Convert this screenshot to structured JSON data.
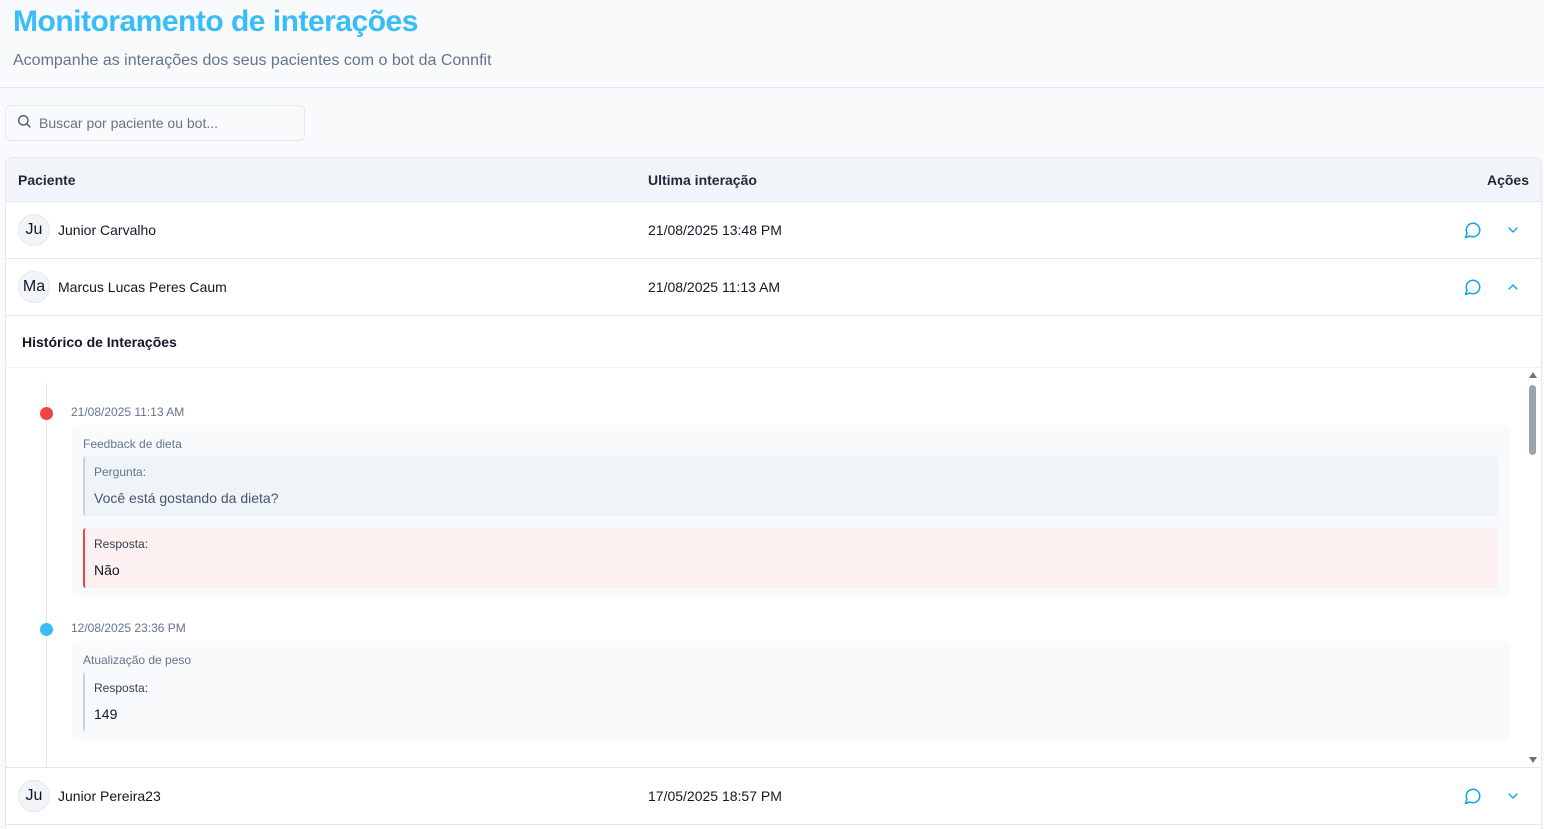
{
  "header": {
    "title": "Monitoramento de interações",
    "subtitle": "Acompanhe as interações dos seus pacientes com o bot da Connfit"
  },
  "search": {
    "placeholder": "Buscar por paciente ou bot...",
    "value": ""
  },
  "table": {
    "columns": {
      "paciente": "Paciente",
      "ultima": "Ultima interação",
      "acoes": "Ações"
    },
    "rows": [
      {
        "initials": "Ju",
        "name": "Junior Carvalho",
        "last": "21/08/2025 13:48 PM",
        "expanded": false
      },
      {
        "initials": "Ma",
        "name": "Marcus Lucas Peres Caum",
        "last": "21/08/2025 11:13 AM",
        "expanded": true
      },
      {
        "initials": "Ju",
        "name": "Junior Pereira23",
        "last": "17/05/2025 18:57 PM",
        "expanded": false
      }
    ]
  },
  "history": {
    "title": "Histórico de Interações",
    "entries": [
      {
        "date": "21/08/2025 11:13 AM",
        "dot_color": "#ef4444",
        "topic": "Feedback de dieta",
        "question_label": "Pergunta:",
        "question": "Você está gostando da dieta?",
        "answer_label": "Resposta:",
        "answer": "Não"
      },
      {
        "date": "12/08/2025 23:36 PM",
        "dot_color": "#38bdf8",
        "topic": "Atualização de peso",
        "answer_label": "Resposta:",
        "answer": "149"
      }
    ]
  },
  "colors": {
    "accent": "#38bdf8",
    "negative": "#ef4444"
  }
}
